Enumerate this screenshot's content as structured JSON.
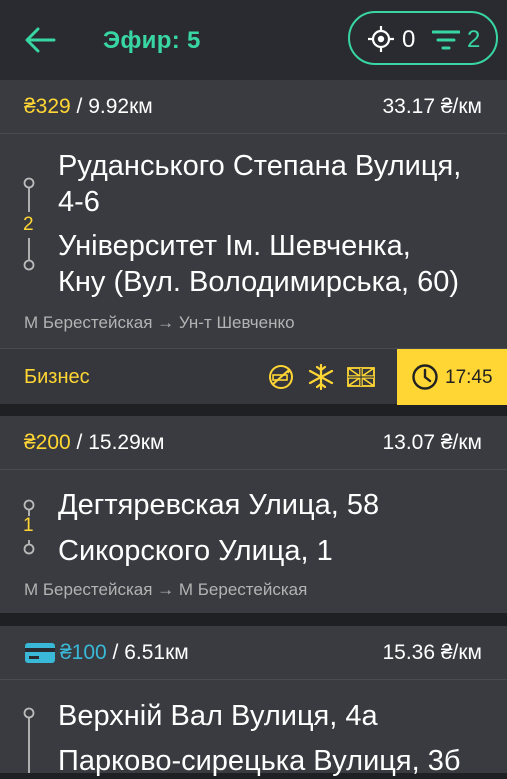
{
  "header": {
    "title": "Эфир: 5",
    "location_count": "0",
    "filter_count": "2"
  },
  "orders": [
    {
      "price": "₴329",
      "distance": " / 9.92км",
      "per_km": "33.17 ₴/км",
      "from": "Руданського Степана Вулиця,",
      "from_2": "4-6",
      "to": "Університет Ім. Шевченка,",
      "to_2": "Кну (Вул. Володимирська, 60)",
      "stops": "2",
      "metro": "М Берестейская → Ун-т Шевченко",
      "class": "Бизнес",
      "features": [
        "no-smoking-icon",
        "snowflake-icon",
        "uk-flag-icon"
      ],
      "time": "17:45"
    },
    {
      "price": "₴200",
      "distance": " / 15.29км",
      "per_km": "13.07 ₴/км",
      "from": "Дегтяревская Улица, 58",
      "to": "Сикорского Улица, 1",
      "stops": "1",
      "metro": "М Берестейская → М Берестейская"
    },
    {
      "payment_icon": "credit-card-icon",
      "price": "₴100",
      "distance": " / 6.51км",
      "per_km": "15.36 ₴/км",
      "from": "Верхній Вал Вулиця, 4а",
      "to": "Парково-сирецька Вулиця, 3б"
    }
  ],
  "colors": {
    "accent": "#38d6a2",
    "price": "#ffd633",
    "card_payment": "#39b8d8",
    "card_bg": "#3a3b40",
    "background": "#1f2024"
  }
}
